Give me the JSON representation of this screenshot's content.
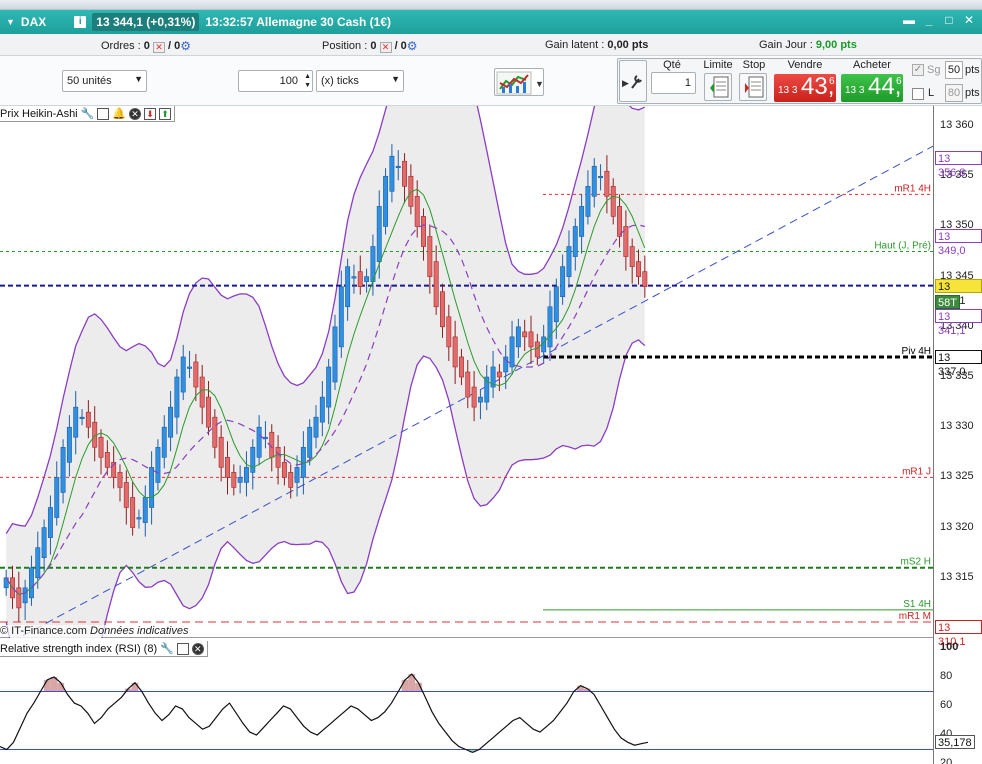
{
  "title_bar": {
    "symbol": "DAX",
    "quote": "13 344,1 (+0,31%)",
    "time_instrument": "13:32:57 Allemagne 30 Cash (1€)"
  },
  "stats": {
    "orders_label": "Ordres :",
    "orders_value": "0",
    "orders_total": "/ 0",
    "position_label": "Position :",
    "position_value": "0",
    "position_total": "/ 0",
    "latent_label": "Gain latent :",
    "latent_value": "0,00 pts",
    "day_label": "Gain Jour :",
    "day_value": "9,00 pts"
  },
  "toolbar": {
    "units_select": "50 unités",
    "ticks_value": "100",
    "ticks_select": "(x) ticks"
  },
  "order_panel": {
    "qty_label": "Qté",
    "qty_value": "1",
    "limit_label": "Limite",
    "stop_label": "Stop",
    "sell_label": "Vendre",
    "buy_label": "Acheter",
    "sell_price_small": "13 3",
    "sell_price_big": "43,",
    "sell_price_sup": "6",
    "buy_price_small": "13 3",
    "buy_price_big": "44,",
    "buy_price_sup": "6",
    "sg_label": "Sg",
    "sg_value": "50",
    "l_label": "L",
    "l_value": "80",
    "pts1": "pts",
    "pts2": "pts"
  },
  "price_pane": {
    "indicator_label": "Prix Heikin-Ashi",
    "source_text": "© IT-Finance.com",
    "source_note": "Données indicatives",
    "level_labels": [
      "mR1 4H",
      "Haut (J, Pré)",
      "Piv 4H",
      "mR1 J",
      "mS2 H",
      "S1 4H",
      "mR1 M"
    ],
    "axis_ticks": [
      "13 360",
      "13 355",
      "13 350",
      "13 345",
      "13 340",
      "13 335",
      "13 330",
      "13 325",
      "13 320",
      "13 315"
    ],
    "price_tags": [
      {
        "text": "13 356,8",
        "kind": "purple"
      },
      {
        "text": "13 349,0",
        "kind": "purple"
      },
      {
        "text": "13 344,1",
        "kind": "current"
      },
      {
        "text": "58T",
        "kind": "timer"
      },
      {
        "text": "13 341,1",
        "kind": "purple"
      },
      {
        "text": "13 337,0",
        "kind": "black"
      },
      {
        "text": "13 310,1",
        "kind": "red"
      }
    ]
  },
  "rsi_pane": {
    "indicator_label": "Relative strength index (RSI) (8)",
    "axis_ticks": [
      "100",
      "80",
      "60",
      "40",
      "20"
    ],
    "value_tag": "35,178"
  },
  "chart_data": {
    "type": "candlestick",
    "ylim": [
      13309,
      13362
    ],
    "levels": [
      {
        "name": "mR1 4H",
        "value": 13353.2
      },
      {
        "name": "Haut (J, Pré)",
        "value": 13347.5
      },
      {
        "name": "Piv 4H",
        "value": 13337.0
      },
      {
        "name": "mR1 J",
        "value": 13325.0
      },
      {
        "name": "mS2 H",
        "value": 13316.0
      },
      {
        "name": "S1 4H",
        "value": 13311.8
      },
      {
        "name": "mR1 M",
        "value": 13310.6
      },
      {
        "name": "current",
        "value": 13344.1
      }
    ],
    "series": [
      {
        "name": "Prix Heikin-Ashi",
        "close": [
          13315,
          13313,
          13312,
          13314,
          13316,
          13318,
          13320,
          13322,
          13325,
          13328,
          13330,
          13332,
          13331,
          13330,
          13328,
          13327,
          13326,
          13325,
          13324,
          13322,
          13320,
          13321,
          13323,
          13326,
          13328,
          13330,
          13332,
          13335,
          13337,
          13336,
          13334,
          13332,
          13330,
          13328,
          13326,
          13325,
          13324,
          13325,
          13326,
          13328,
          13330,
          13329,
          13327,
          13326,
          13325,
          13324,
          13326,
          13328,
          13330,
          13331,
          13333,
          13336,
          13340,
          13344,
          13346,
          13345,
          13344,
          13345,
          13348,
          13352,
          13355,
          13357,
          13356,
          13354,
          13352,
          13350,
          13348,
          13345,
          13342,
          13340,
          13338,
          13336,
          13335,
          13333,
          13332,
          13333,
          13335,
          13336,
          13335,
          13337,
          13339,
          13340,
          13339,
          13338,
          13337,
          13339,
          13342,
          13344,
          13346,
          13348,
          13350,
          13352,
          13354,
          13356,
          13355,
          13353,
          13351,
          13349,
          13347,
          13346,
          13345,
          13344
        ]
      }
    ],
    "rsi": {
      "name": "RSI (8)",
      "upper": 70,
      "lower": 30,
      "ylim": [
        20,
        100
      ],
      "values": [
        32,
        30,
        35,
        45,
        55,
        62,
        70,
        78,
        80,
        76,
        68,
        62,
        60,
        55,
        48,
        52,
        58,
        62,
        66,
        72,
        76,
        70,
        62,
        55,
        50,
        54,
        60,
        58,
        52,
        48,
        44,
        46,
        52,
        58,
        62,
        55,
        48,
        42,
        40,
        45,
        50,
        55,
        60,
        58,
        52,
        46,
        42,
        40,
        44,
        48,
        52,
        56,
        60,
        58,
        54,
        50,
        52,
        56,
        62,
        70,
        78,
        82,
        76,
        66,
        56,
        48,
        42,
        36,
        32,
        30,
        28,
        30,
        34,
        38,
        42,
        46,
        50,
        52,
        48,
        44,
        42,
        46,
        50,
        56,
        62,
        70,
        74,
        72,
        68,
        60,
        52,
        44,
        38,
        35,
        33,
        34,
        35
      ]
    }
  }
}
